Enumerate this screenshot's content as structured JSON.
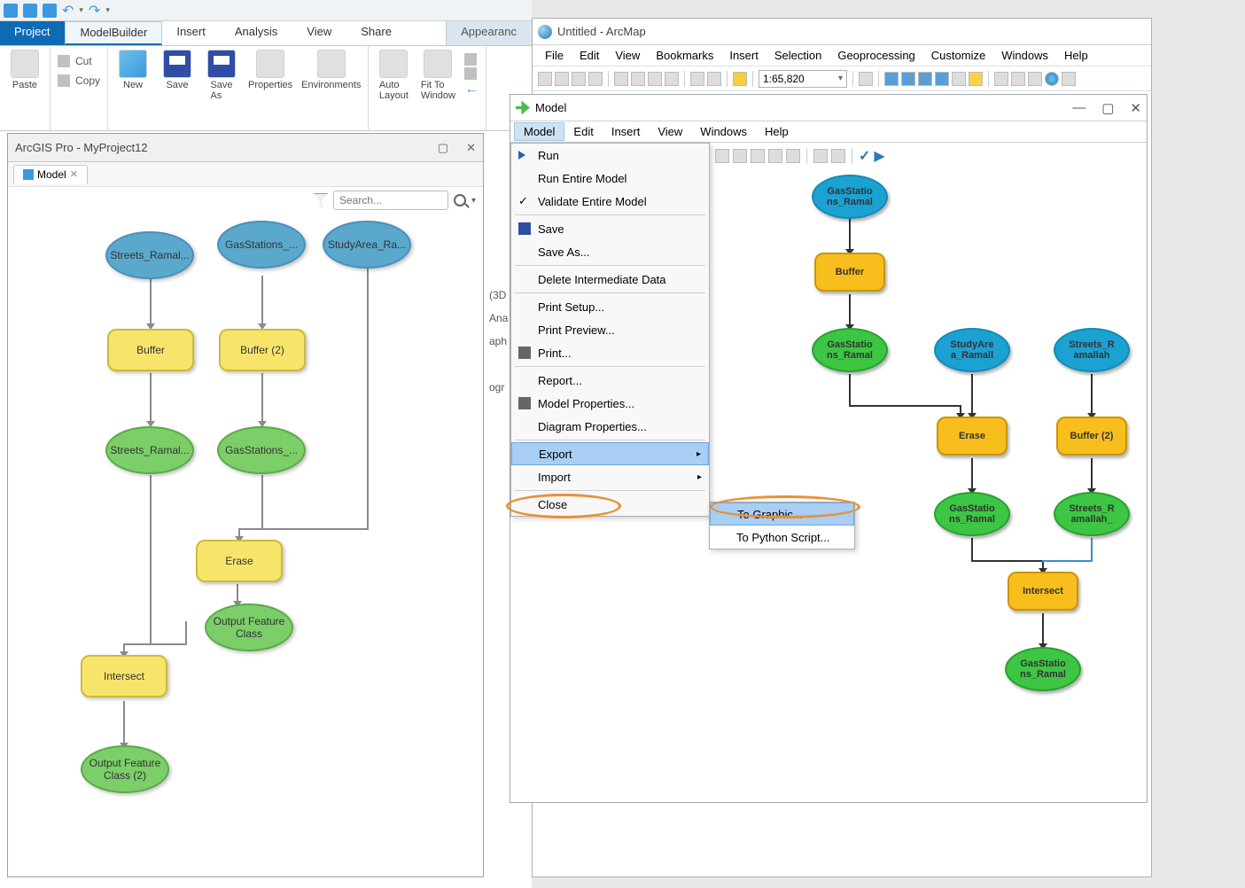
{
  "pro": {
    "qat_labels": [
      "open",
      "save",
      "save-all",
      "undo",
      "redo"
    ],
    "tabs": {
      "project": "Project",
      "modelbuilder": "ModelBuilder",
      "insert": "Insert",
      "analysis": "Analysis",
      "view": "View",
      "share": "Share",
      "appearance": "Appearanc"
    },
    "clip": {
      "cut": "Cut",
      "copy": "Copy",
      "paste": "Paste"
    },
    "model_group": {
      "new": "New",
      "save": "Save",
      "saveas": "Save\nAs",
      "properties": "Properties",
      "env": "Environments"
    },
    "view_group": {
      "auto": "Auto\nLayout",
      "fit": "Fit To\nWindow"
    },
    "sub_title": "ArcGIS Pro - MyProject12",
    "model_tab": "Model",
    "search_ph": "Search...",
    "nodes": {
      "n1": "Streets_Ramal...",
      "n2": "GasStations_...",
      "n3": "StudyArea_Ra...",
      "b1": "Buffer",
      "b2": "Buffer (2)",
      "g1": "Streets_Ramal...",
      "g2": "GasStations_...",
      "er": "Erase",
      "ofc": "Output Feature\nClass",
      "int": "Intersect",
      "ofc2": "Output Feature\nClass (2)"
    },
    "peek": {
      "l1": "(3D",
      "l2": "Ana",
      "l3": "aph",
      "l4": "ogr"
    }
  },
  "am": {
    "title": "Untitled - ArcMap",
    "menu": {
      "file": "File",
      "edit": "Edit",
      "view": "View",
      "bookmarks": "Bookmarks",
      "insert": "Insert",
      "selection": "Selection",
      "geoprocessing": "Geoprocessing",
      "customize": "Customize",
      "windows": "Windows",
      "help": "Help"
    },
    "scale": "1:65,820"
  },
  "mw": {
    "title": "Model",
    "menu": {
      "model": "Model",
      "edit": "Edit",
      "insert": "Insert",
      "view": "View",
      "windows": "Windows",
      "help": "Help"
    },
    "dd": {
      "run": "Run",
      "runall": "Run Entire Model",
      "validate": "Validate Entire Model",
      "save": "Save",
      "saveas": "Save As...",
      "delint": "Delete Intermediate Data",
      "printsetup": "Print Setup...",
      "preview": "Print Preview...",
      "print": "Print...",
      "report": "Report...",
      "modelprop": "Model Properties...",
      "diagprop": "Diagram Properties...",
      "export": "Export",
      "import": "Import",
      "close": "Close"
    },
    "sub": {
      "graphic": "To Graphic...",
      "python": "To Python Script..."
    },
    "nodes": {
      "a1": "GasStatio\nns_Ramal",
      "buf": "Buffer",
      "g1": "GasStatio\nns_Ramal",
      "sa": "StudyAre\na_Ramall",
      "sr": "Streets_R\namallah",
      "er": "Erase",
      "b2": "Buffer (2)",
      "g2": "GasStatio\nns_Ramal",
      "g3": "Streets_R\namallah_",
      "int": "Intersect",
      "out": "GasStatio\nns_Ramal"
    }
  }
}
